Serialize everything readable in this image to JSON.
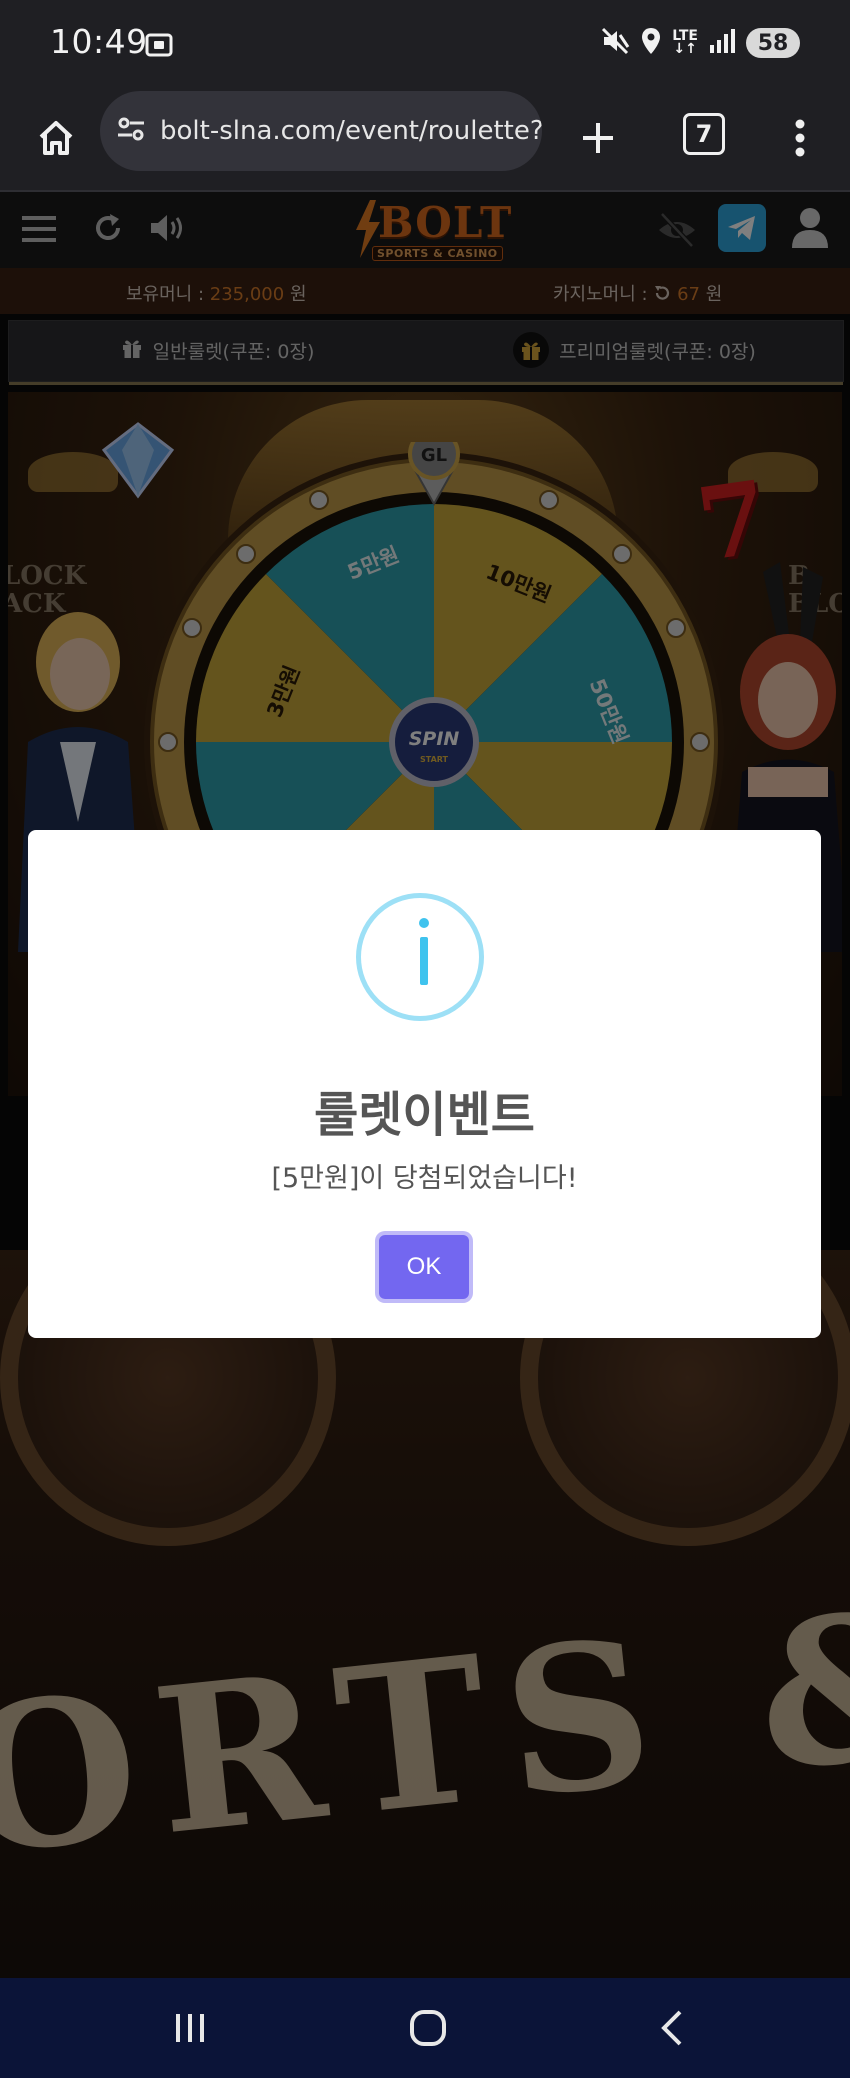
{
  "status_bar": {
    "time": "10:49",
    "network": "LTE",
    "battery": "58",
    "icons": [
      "screenshot-icon",
      "mute-icon",
      "location-icon",
      "signal-icon"
    ]
  },
  "browser": {
    "url": "bolt-slna.com/event/roulette?r",
    "tab_count": "7",
    "icons": [
      "home-icon",
      "site-settings-icon",
      "plus-icon",
      "more-vert-icon"
    ]
  },
  "site_header": {
    "logo_text": "BOLT",
    "logo_subtitle": "SPORTS & CASINO",
    "icons": [
      "menu-icon",
      "refresh-icon",
      "volume-icon",
      "eye-off-icon",
      "telegram-icon",
      "user-icon"
    ],
    "telegram_color": "#2ea6df"
  },
  "balance": {
    "money_label": "보유머니 :",
    "money_value": "235,000",
    "money_unit": "원",
    "casino_label": "카지노머니 :",
    "casino_value": "67",
    "casino_unit": "원",
    "amount_color": "#d47a2a"
  },
  "tabs": [
    {
      "label": "일반룰렛(쿠폰: 0장)",
      "icon": "gift-icon"
    },
    {
      "label": "프리미엄룰렛(쿠폰: 0장)",
      "icon": "gift-icon"
    }
  ],
  "roulette": {
    "badge": "GL",
    "center_label": "SPIN",
    "center_sublabel": "START",
    "segments": [
      {
        "label": "5만원",
        "color": "#2fa0ae"
      },
      {
        "label": "10만원",
        "color": "#c9a83a"
      },
      {
        "label": "50만원",
        "color": "#2fa0ae"
      },
      {
        "label": "3만원",
        "color": "#c9a83a"
      }
    ],
    "decorations": {
      "left_word": [
        "LOCK",
        "ACK"
      ],
      "right_word": [
        "B",
        "BLOC"
      ],
      "seven": "7"
    }
  },
  "background": {
    "sign_text": "ORTS & C"
  },
  "dialog": {
    "icon": "info-icon",
    "title": "룰렛이벤트",
    "message": "[5만원]이 당첨되었습니다!",
    "ok_label": "OK",
    "accent": "#7367f0",
    "info_color": "#3fc3ee"
  },
  "nav_bar": {
    "icons": [
      "recent-apps-icon",
      "home-circle-icon",
      "back-icon"
    ]
  }
}
